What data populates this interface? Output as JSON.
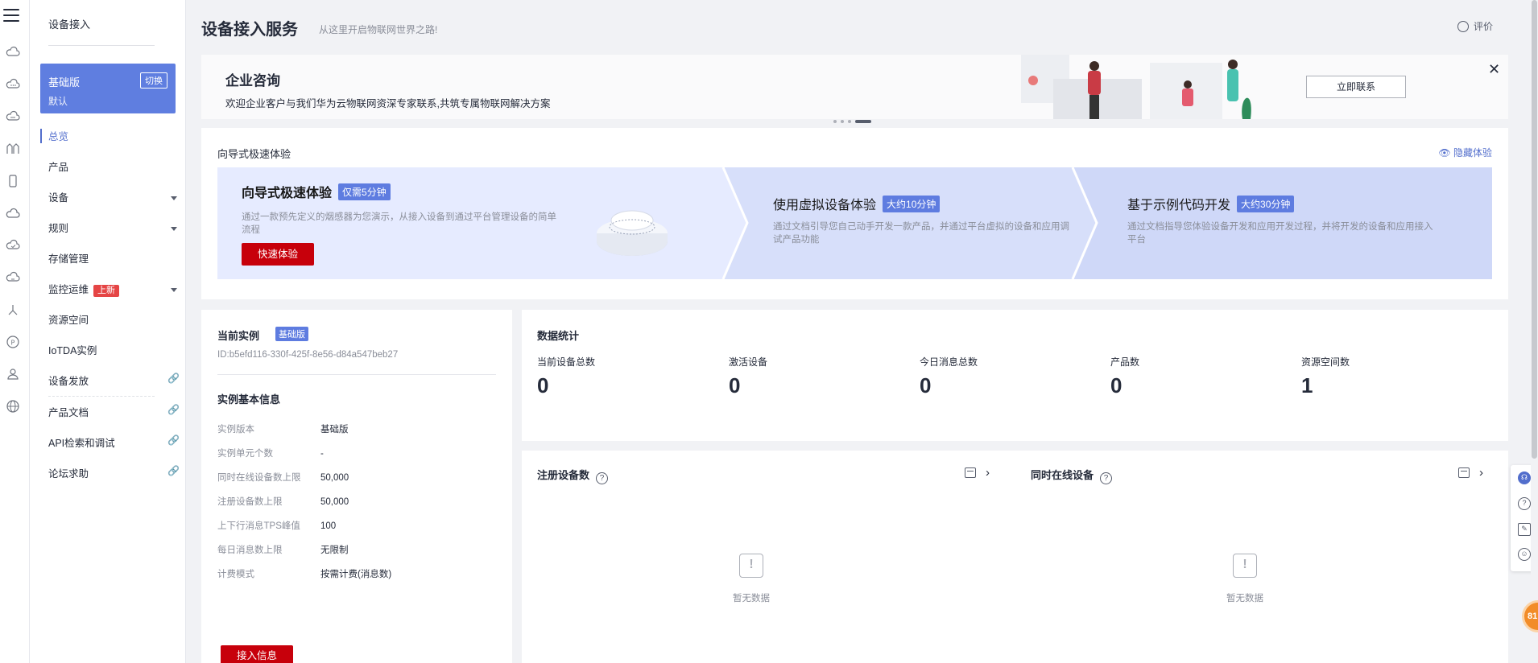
{
  "sidebar": {
    "title": "设备接入",
    "edition": {
      "name": "基础版",
      "sub": "默认",
      "switch_label": "切换"
    },
    "items": [
      {
        "label": "总览"
      },
      {
        "label": "产品"
      },
      {
        "label": "设备"
      },
      {
        "label": "规则"
      },
      {
        "label": "存储管理"
      },
      {
        "label": "监控运维",
        "badge": "上新"
      },
      {
        "label": "资源空间"
      },
      {
        "label": "IoTDA实例"
      },
      {
        "label": "设备发放"
      },
      {
        "label": "产品文档"
      },
      {
        "label": "API检索和调试"
      },
      {
        "label": "论坛求助"
      }
    ]
  },
  "header": {
    "title": "设备接入服务",
    "subtitle": "从这里开启物联网世界之路!",
    "rate_label": "评价"
  },
  "banner": {
    "title": "企业咨询",
    "desc": "欢迎企业客户与我们华为云物联网资深专家联系,共筑专属物联网解决方案",
    "button": "立即联系",
    "close": "✕"
  },
  "wizard": {
    "title": "向导式极速体验",
    "hide_label": "隐藏体验",
    "steps": [
      {
        "title": "向导式极速体验",
        "tag": "仅需5分钟",
        "desc": "通过一款预先定义的烟感器为您演示，从接入设备到通过平台管理设备的简单流程",
        "button": "快速体验"
      },
      {
        "title": "使用虚拟设备体验",
        "tag": "大约10分钟",
        "desc": "通过文档引导您自己动手开发一款产品，并通过平台虚拟的设备和应用调试产品功能"
      },
      {
        "title": "基于示例代码开发",
        "tag": "大约30分钟",
        "desc": "通过文档指导您体验设备开发和应用开发过程，并将开发的设备和应用接入平台"
      }
    ]
  },
  "instance": {
    "title": "当前实例",
    "tag": "基础版",
    "id": "ID:b5efd116-330f-425f-8e56-d84a547beb27",
    "basic_title": "实例基本信息",
    "rows": [
      {
        "k": "实例版本",
        "v": "基础版"
      },
      {
        "k": "实例单元个数",
        "v": "-"
      },
      {
        "k": "同时在线设备数上限",
        "v": "50,000"
      },
      {
        "k": "注册设备数上限",
        "v": "50,000"
      },
      {
        "k": "上下行消息TPS峰值",
        "v": "100"
      },
      {
        "k": "每日消息数上限",
        "v": "无限制"
      },
      {
        "k": "计费模式",
        "v": "按需计费(消息数)"
      }
    ],
    "button": "接入信息"
  },
  "stats": {
    "title": "数据统计",
    "items": [
      {
        "label": "当前设备总数",
        "value": "0"
      },
      {
        "label": "激活设备",
        "value": "0"
      },
      {
        "label": "今日消息总数",
        "value": "0"
      },
      {
        "label": "产品数",
        "value": "0"
      },
      {
        "label": "资源空间数",
        "value": "1"
      }
    ]
  },
  "charts": [
    {
      "title": "注册设备数",
      "empty": "暂无数据"
    },
    {
      "title": "同时在线设备",
      "empty": "暂无数据"
    }
  ],
  "float_badge": "81",
  "colors": {
    "accent": "#526ecc",
    "primary_button": "#c7000b",
    "edition_bg": "#5f7ee0",
    "badge_new": "#e54545"
  }
}
